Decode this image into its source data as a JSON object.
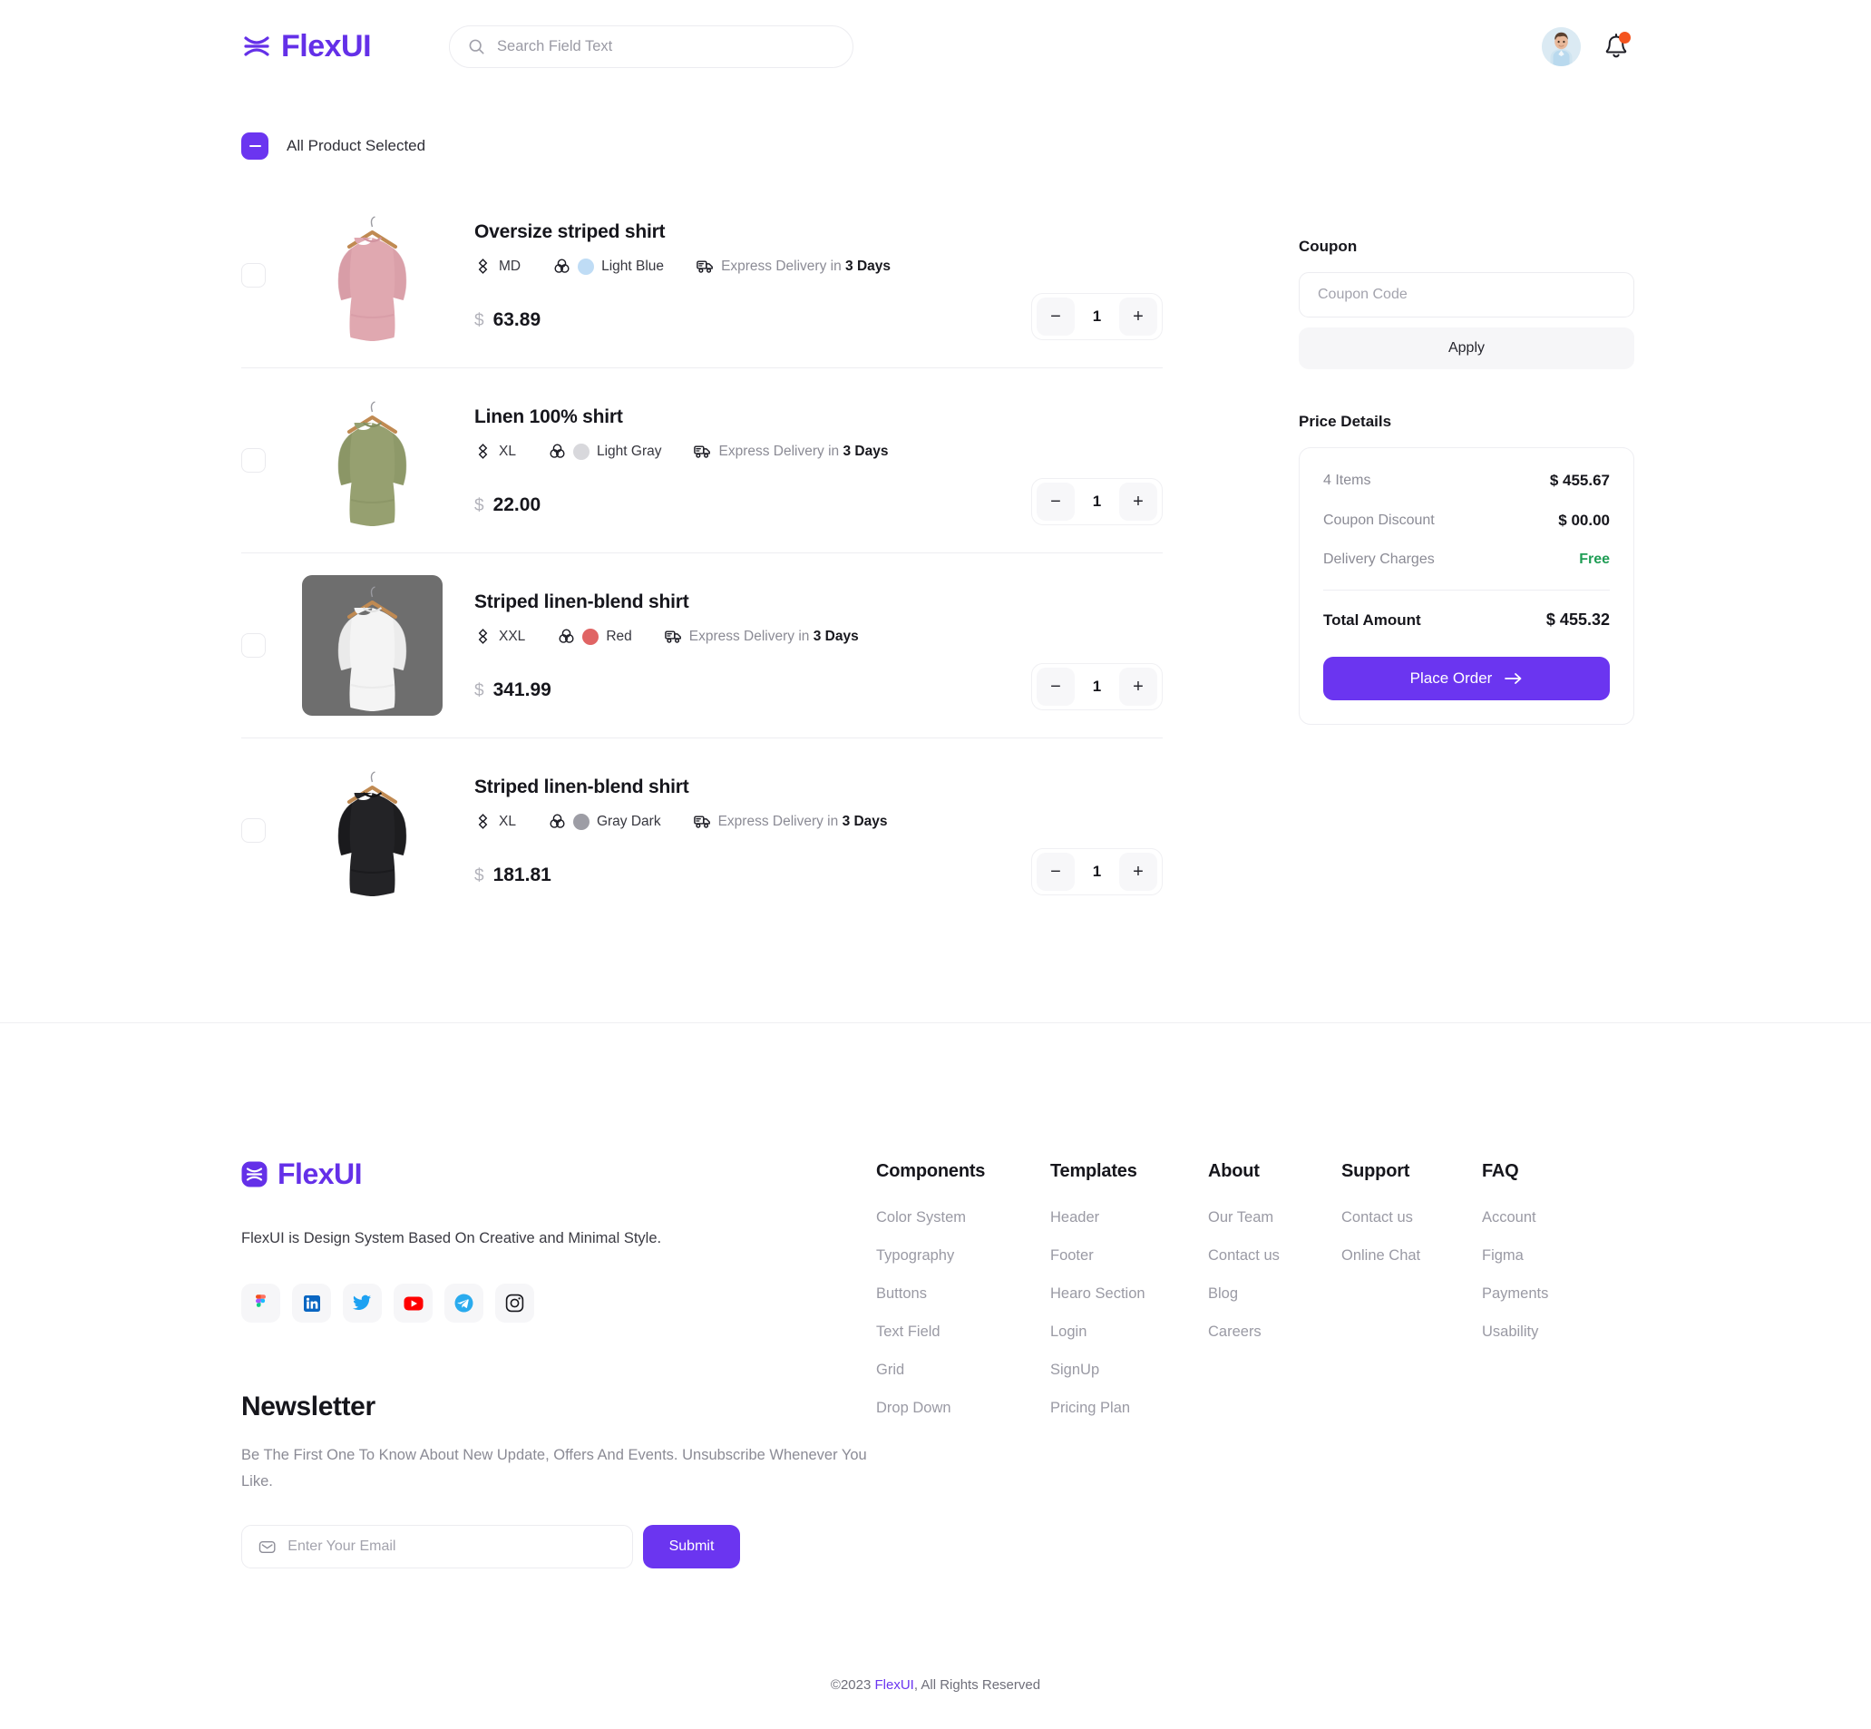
{
  "header": {
    "logo_text": "FlexUI",
    "logo_icon": "flexui-logo-icon",
    "search": {
      "placeholder": "Search Field Text",
      "value": "",
      "icon": "search-icon"
    },
    "avatar_alt": "user-avatar",
    "bell_icon": "notification-bell-icon",
    "has_notification": true
  },
  "cart": {
    "select_all_label": "All Product Selected",
    "select_all_state": "indeterminate",
    "products": [
      {
        "title": "Oversize striped shirt",
        "size": "MD",
        "color_name": "Light Blue",
        "color_hex": "#bfdcf5",
        "delivery_prefix": "Express Delivery in ",
        "delivery_days": "3 Days",
        "currency": "$",
        "price": "63.89",
        "quantity": "1",
        "selected": false,
        "thumb_bg": "#ffffff",
        "garment_color": "#e0a8b0",
        "garment_shade": "#d194a0"
      },
      {
        "title": "Linen 100% shirt",
        "size": "XL",
        "color_name": "Light Gray",
        "color_hex": "#d8d8dc",
        "delivery_prefix": "Express Delivery in ",
        "delivery_days": "3 Days",
        "currency": "$",
        "price": "22.00",
        "quantity": "1",
        "selected": false,
        "thumb_bg": "#ffffff",
        "garment_color": "#96a070",
        "garment_shade": "#838e5f"
      },
      {
        "title": "Striped linen-blend shirt",
        "size": "XXL",
        "color_name": "Red",
        "color_hex": "#e06464",
        "delivery_prefix": "Express Delivery in ",
        "delivery_days": "3 Days",
        "currency": "$",
        "price": "341.99",
        "quantity": "1",
        "selected": false,
        "thumb_bg": "#6e6e6e",
        "garment_color": "#f4f4f4",
        "garment_shade": "#e2e2e2"
      },
      {
        "title": "Striped linen-blend shirt",
        "size": "XL",
        "color_name": "Gray Dark",
        "color_hex": "#9d9da5",
        "delivery_prefix": "Express Delivery in ",
        "delivery_days": "3 Days",
        "currency": "$",
        "price": "181.81",
        "quantity": "1",
        "selected": false,
        "thumb_bg": "#ffffff",
        "garment_color": "#232326",
        "garment_shade": "#141416"
      }
    ],
    "stepper": {
      "minus": "−",
      "plus": "+"
    }
  },
  "summary": {
    "coupon_heading": "Coupon",
    "coupon_placeholder": "Coupon Code",
    "coupon_value": "",
    "apply_label": "Apply",
    "price_heading": "Price Details",
    "rows": [
      {
        "label": "4 Items",
        "value": "$ 455.67",
        "style": "normal"
      },
      {
        "label": "Coupon Discount",
        "value": "$ 00.00",
        "style": "normal"
      },
      {
        "label": "Delivery Charges",
        "value": "Free",
        "style": "free"
      }
    ],
    "total_label": "Total Amount",
    "total_value": "$ 455.32",
    "place_order_label": "Place Order",
    "place_order_icon": "arrow-right-icon"
  },
  "footer": {
    "logo_text": "FlexUI",
    "description": "FlexUI is Design System Based On Creative and Minimal Style.",
    "socials": [
      {
        "name": "figma-icon",
        "label": "Figma"
      },
      {
        "name": "linkedin-icon",
        "label": "LinkedIn"
      },
      {
        "name": "twitter-icon",
        "label": "Twitter"
      },
      {
        "name": "youtube-icon",
        "label": "YouTube"
      },
      {
        "name": "telegram-icon",
        "label": "Telegram"
      },
      {
        "name": "instagram-icon",
        "label": "Instagram"
      }
    ],
    "newsletter": {
      "title": "Newsletter",
      "description": "Be The First One To Know  About New Update, Offers And Events. Unsubscribe Whenever You Like.",
      "placeholder": "Enter Your Email",
      "value": "",
      "submit_label": "Submit",
      "mail_icon": "mail-icon"
    },
    "columns": [
      {
        "title": "Components",
        "links": [
          "Color System",
          "Typography",
          "Buttons",
          "Text Field",
          "Grid",
          "Drop Down"
        ]
      },
      {
        "title": "Templates",
        "links": [
          "Header",
          "Footer",
          "Hearo Section",
          "Login",
          "SignUp",
          "Pricing Plan"
        ]
      },
      {
        "title": "About",
        "links": [
          "Our Team",
          "Contact us",
          "Blog",
          "Careers"
        ]
      },
      {
        "title": "Support",
        "links": [
          "Contact us",
          "Online Chat"
        ]
      },
      {
        "title": "FAQ",
        "links": [
          "Account",
          "Figma",
          "Payments",
          "Usability"
        ]
      }
    ],
    "copyright_pre": "©2023 ",
    "copyright_brand": "FlexUI",
    "copyright_post": ", All Rights Reserved"
  },
  "colors": {
    "accent": "#6b35f0",
    "brand": "#6430e8",
    "free_green": "#1f9d55",
    "notification": "#f4541f"
  }
}
